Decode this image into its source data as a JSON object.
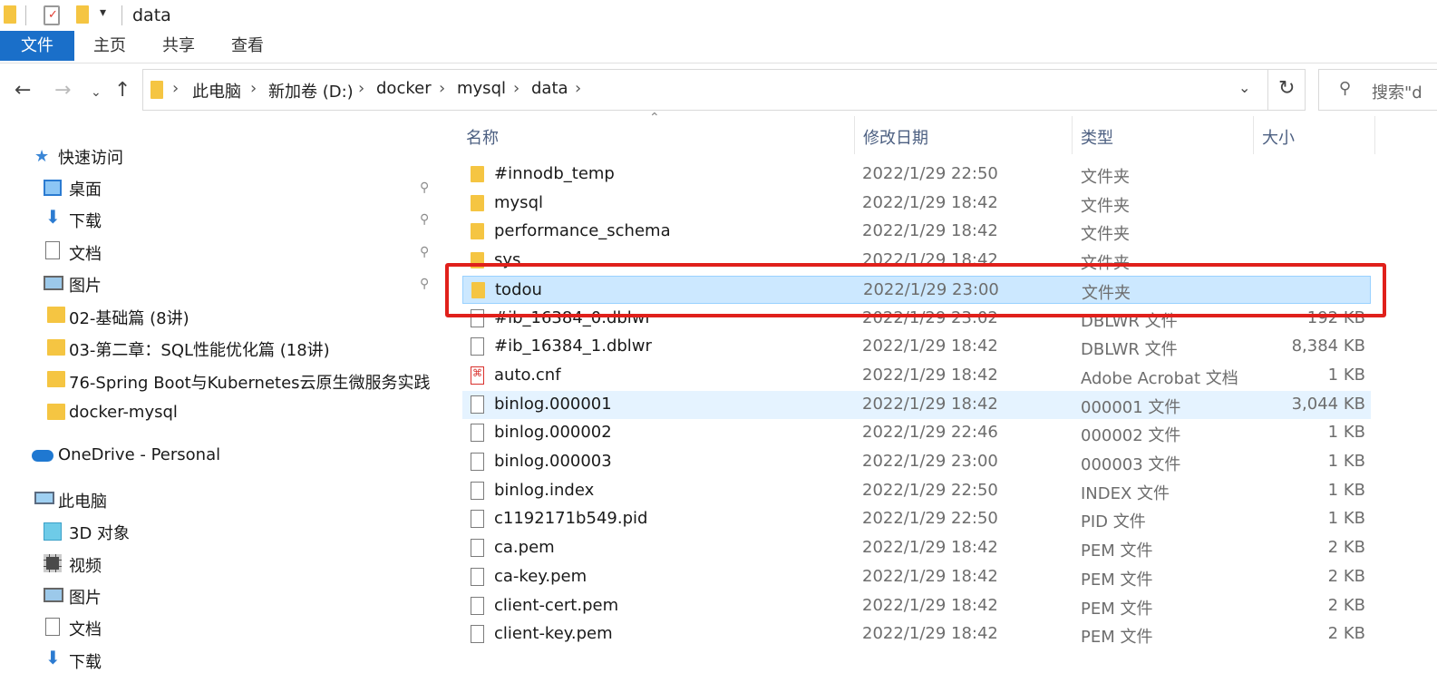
{
  "window": {
    "title": "data"
  },
  "ribbon": {
    "tabs": [
      "文件",
      "主页",
      "共享",
      "查看"
    ]
  },
  "nav": {
    "breadcrumbs": [
      "此电脑",
      "新加卷 (D:)",
      "docker",
      "mysql",
      "data"
    ],
    "search_placeholder": "搜索\"d"
  },
  "sidebar": {
    "quick_access": "快速访问",
    "pinned": [
      "桌面",
      "下载",
      "文档",
      "图片"
    ],
    "folders": [
      "02-基础篇 (8讲)",
      "03-第二章：SQL性能优化篇 (18讲)",
      "76-Spring Boot与Kubernetes云原生微服务实践",
      "docker-mysql"
    ],
    "onedrive": "OneDrive - Personal",
    "this_pc": "此电脑",
    "pc_items": [
      "3D 对象",
      "视频",
      "图片",
      "文档",
      "下载"
    ]
  },
  "columns": {
    "name": "名称",
    "date": "修改日期",
    "type": "类型",
    "size": "大小"
  },
  "files": [
    {
      "name": "#innodb_temp",
      "date": "2022/1/29 22:50",
      "type": "文件夹",
      "size": "",
      "icon": "folder"
    },
    {
      "name": "mysql",
      "date": "2022/1/29 18:42",
      "type": "文件夹",
      "size": "",
      "icon": "folder"
    },
    {
      "name": "performance_schema",
      "date": "2022/1/29 18:42",
      "type": "文件夹",
      "size": "",
      "icon": "folder"
    },
    {
      "name": "sys",
      "date": "2022/1/29 18:42",
      "type": "文件夹",
      "size": "",
      "icon": "folder"
    },
    {
      "name": "todou",
      "date": "2022/1/29 23:00",
      "type": "文件夹",
      "size": "",
      "icon": "folder",
      "selected": true
    },
    {
      "name": "#ib_16384_0.dblwr",
      "date": "2022/1/29 23:02",
      "type": "DBLWR 文件",
      "size": "192 KB",
      "icon": "doc"
    },
    {
      "name": "#ib_16384_1.dblwr",
      "date": "2022/1/29 18:42",
      "type": "DBLWR 文件",
      "size": "8,384 KB",
      "icon": "doc"
    },
    {
      "name": "auto.cnf",
      "date": "2022/1/29 18:42",
      "type": "Adobe Acrobat 文档",
      "size": "1 KB",
      "icon": "pdf"
    },
    {
      "name": "binlog.000001",
      "date": "2022/1/29 18:42",
      "type": "000001 文件",
      "size": "3,044 KB",
      "icon": "doc",
      "hover": true
    },
    {
      "name": "binlog.000002",
      "date": "2022/1/29 22:46",
      "type": "000002 文件",
      "size": "1 KB",
      "icon": "doc"
    },
    {
      "name": "binlog.000003",
      "date": "2022/1/29 23:00",
      "type": "000003 文件",
      "size": "1 KB",
      "icon": "doc"
    },
    {
      "name": "binlog.index",
      "date": "2022/1/29 22:50",
      "type": "INDEX 文件",
      "size": "1 KB",
      "icon": "doc"
    },
    {
      "name": "c1192171b549.pid",
      "date": "2022/1/29 22:50",
      "type": "PID 文件",
      "size": "1 KB",
      "icon": "doc"
    },
    {
      "name": "ca.pem",
      "date": "2022/1/29 18:42",
      "type": "PEM 文件",
      "size": "2 KB",
      "icon": "doc"
    },
    {
      "name": "ca-key.pem",
      "date": "2022/1/29 18:42",
      "type": "PEM 文件",
      "size": "2 KB",
      "icon": "doc"
    },
    {
      "name": "client-cert.pem",
      "date": "2022/1/29 18:42",
      "type": "PEM 文件",
      "size": "2 KB",
      "icon": "doc"
    },
    {
      "name": "client-key.pem",
      "date": "2022/1/29 18:42",
      "type": "PEM 文件",
      "size": "2 KB",
      "icon": "doc"
    }
  ],
  "colors": {
    "accent": "#1a6fc9",
    "selection": "#cce8ff",
    "highlight_box": "#e0201b",
    "folder": "#f5c542"
  }
}
